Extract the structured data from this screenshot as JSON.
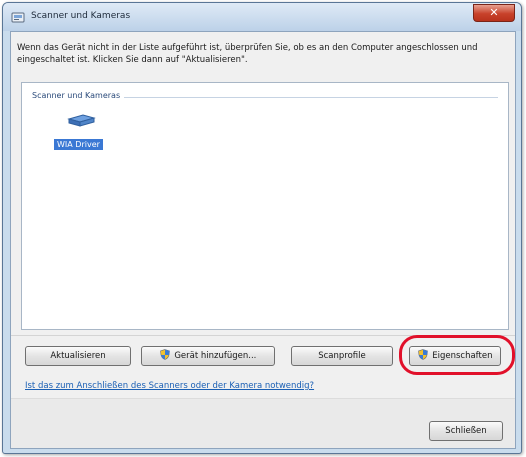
{
  "window": {
    "title": "Scanner und Kameras",
    "close_glyph": "✕"
  },
  "instructions": "Wenn das Gerät nicht in der Liste aufgeführt ist, überprüfen Sie, ob es an den Computer angeschlossen und eingeschaltet ist. Klicken Sie dann auf \"Aktualisieren\".",
  "device_group": {
    "label": "Scanner und Kameras",
    "devices": [
      {
        "name": "WIA Driver",
        "selected": true,
        "icon": "scanner-icon"
      }
    ]
  },
  "buttons": {
    "refresh": "Aktualisieren",
    "add_device": "Gerät hinzufügen...",
    "scan_profiles": "Scanprofile",
    "properties": "Eigenschaften",
    "close": "Schließen"
  },
  "help_link": "Ist das zum Anschließen des Scanners oder der Kamera notwendig?",
  "colors": {
    "accent": "#3a78d4",
    "highlight": "#e1102a",
    "link": "#1a5fb4"
  }
}
